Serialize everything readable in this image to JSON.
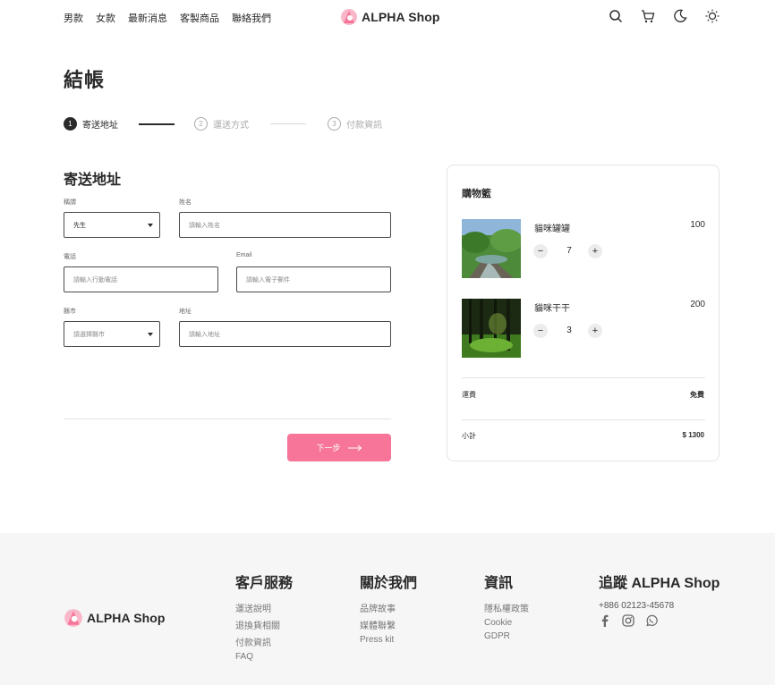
{
  "header": {
    "nav": [
      "男款",
      "女款",
      "最新消息",
      "客製商品",
      "聯絡我們"
    ],
    "logo_text": "ALPHA Shop",
    "icons": [
      "search-icon",
      "cart-icon",
      "moon-icon",
      "sun-icon"
    ]
  },
  "page": {
    "title": "結帳"
  },
  "stepper": {
    "steps": [
      {
        "num": "1",
        "label": "寄送地址"
      },
      {
        "num": "2",
        "label": "運送方式"
      },
      {
        "num": "3",
        "label": "付款資訊"
      }
    ]
  },
  "form": {
    "title": "寄送地址",
    "salutation": {
      "label": "稱謂",
      "value": "先生"
    },
    "name": {
      "label": "姓名",
      "placeholder": "請輸入姓名"
    },
    "phone": {
      "label": "電話",
      "placeholder": "請輸入行動電話"
    },
    "email": {
      "label": "Email",
      "placeholder": "請輸入電子郵件"
    },
    "city": {
      "label": "縣市",
      "placeholder": "請選擇縣市"
    },
    "address": {
      "label": "地址",
      "placeholder": "請輸入地址"
    },
    "next_label": "下一步"
  },
  "cart": {
    "title": "購物籃",
    "items": [
      {
        "name": "貓咪罐罐",
        "price": "100",
        "qty": "7"
      },
      {
        "name": "貓咪干干",
        "price": "200",
        "qty": "3"
      }
    ],
    "shipping_label": "運費",
    "shipping_value": "免費",
    "subtotal_label": "小計",
    "subtotal_value": "$ 1300"
  },
  "footer": {
    "logo_text": "ALPHA Shop",
    "columns": [
      {
        "title": "客戶服務",
        "links": [
          "運送說明",
          "退換貨相關",
          "付款資訊",
          "FAQ"
        ]
      },
      {
        "title": "關於我們",
        "links": [
          "品牌故事",
          "媒體聯繫",
          "Press kit"
        ]
      },
      {
        "title": "資訊",
        "links": [
          "隱私權政策",
          "Cookie",
          "GDPR"
        ]
      }
    ],
    "follow": {
      "title": "追蹤 ALPHA Shop",
      "phone": "+886 02123-45678"
    },
    "social_icons": [
      "facebook-icon",
      "instagram-icon",
      "whatsapp-icon"
    ]
  },
  "colors": {
    "accent": "#f67599",
    "dark": "#2a2a2a"
  }
}
